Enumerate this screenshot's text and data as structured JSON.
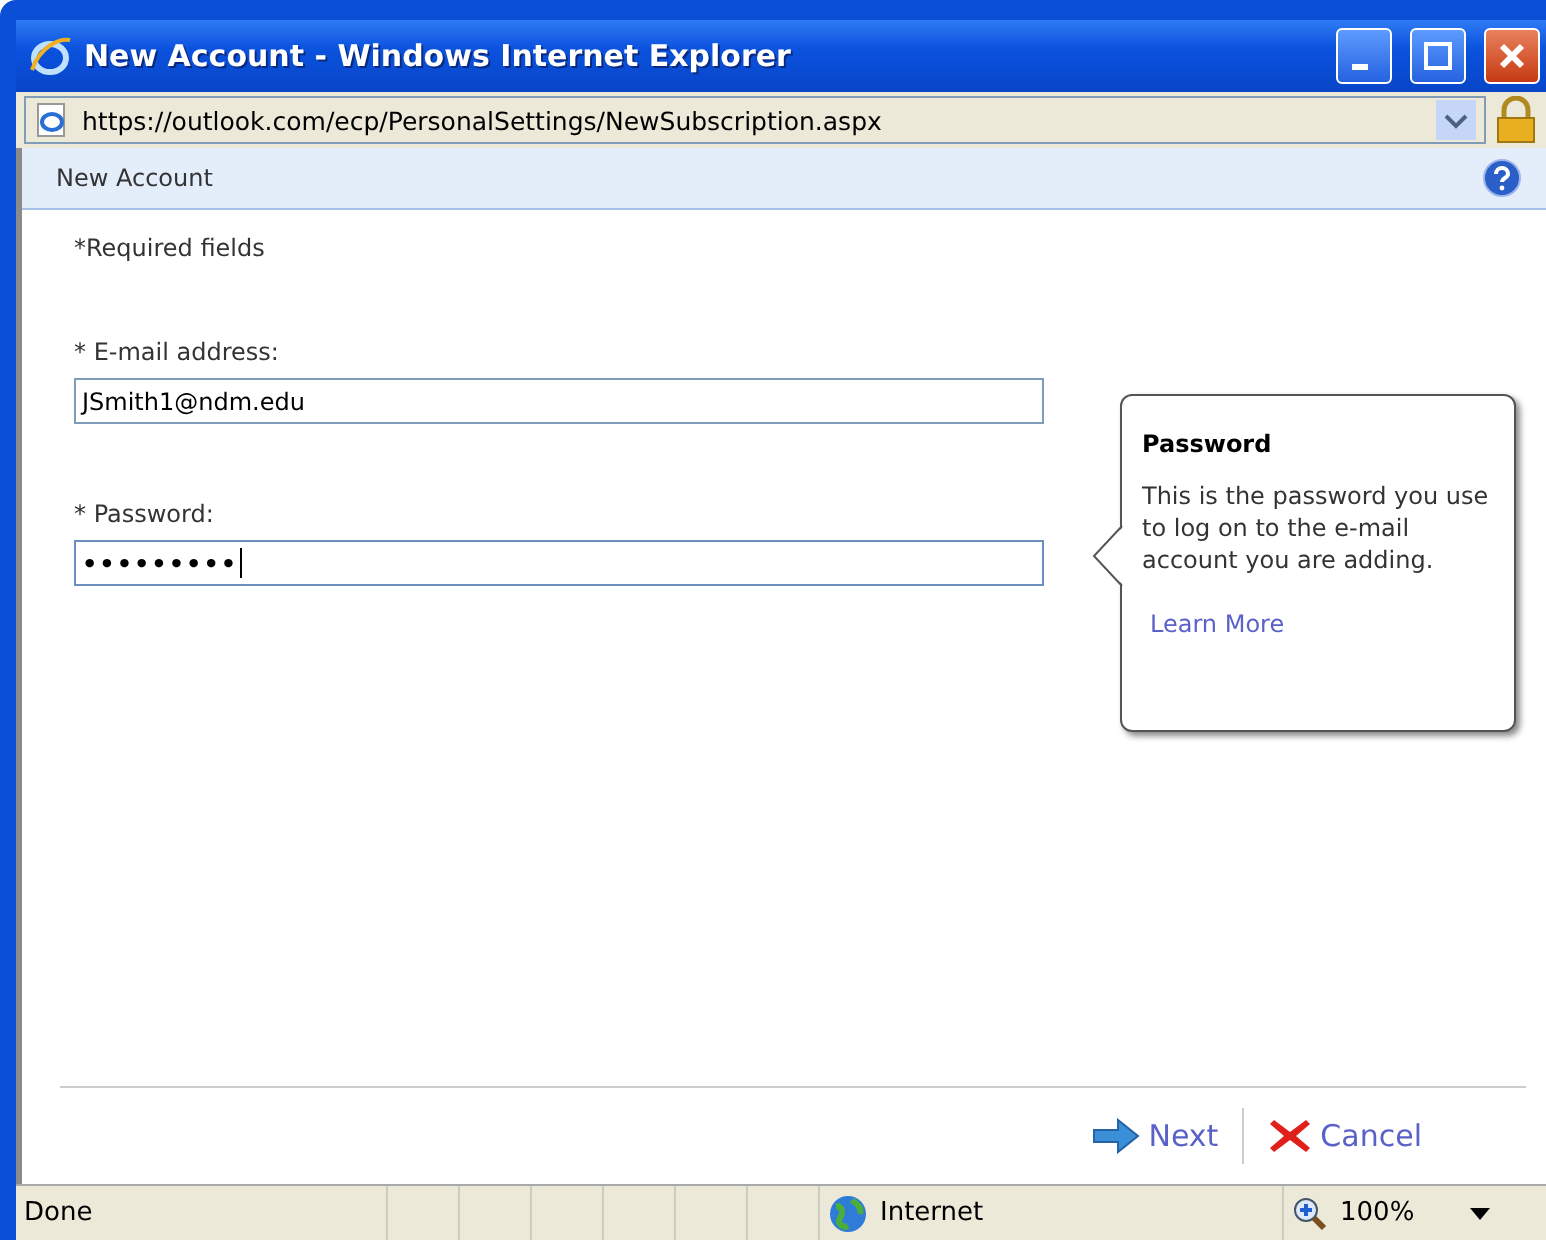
{
  "window": {
    "title": "New Account - Windows Internet Explorer"
  },
  "address_bar": {
    "url": "https://outlook.com/ecp/PersonalSettings/NewSubscription.aspx"
  },
  "page_header": {
    "title": "New Account"
  },
  "form": {
    "note": "*Required fields",
    "fields": [
      {
        "label": "* E-mail address:",
        "value": "JSmith1@ndm.edu",
        "kind": "text",
        "focused": false
      },
      {
        "label": "* Password:",
        "value": "•••••••••",
        "kind": "password",
        "focused": true
      }
    ]
  },
  "tooltip": {
    "title": "Password",
    "body": "This is the password you use to log on to the e-mail account you are adding.",
    "link": "Learn More"
  },
  "buttons": [
    {
      "label": "Next",
      "kind": "next"
    },
    {
      "label": "Cancel",
      "kind": "cancel"
    }
  ],
  "status_bar": {
    "status": "Done",
    "zone": "Internet",
    "zoom": "100%"
  }
}
